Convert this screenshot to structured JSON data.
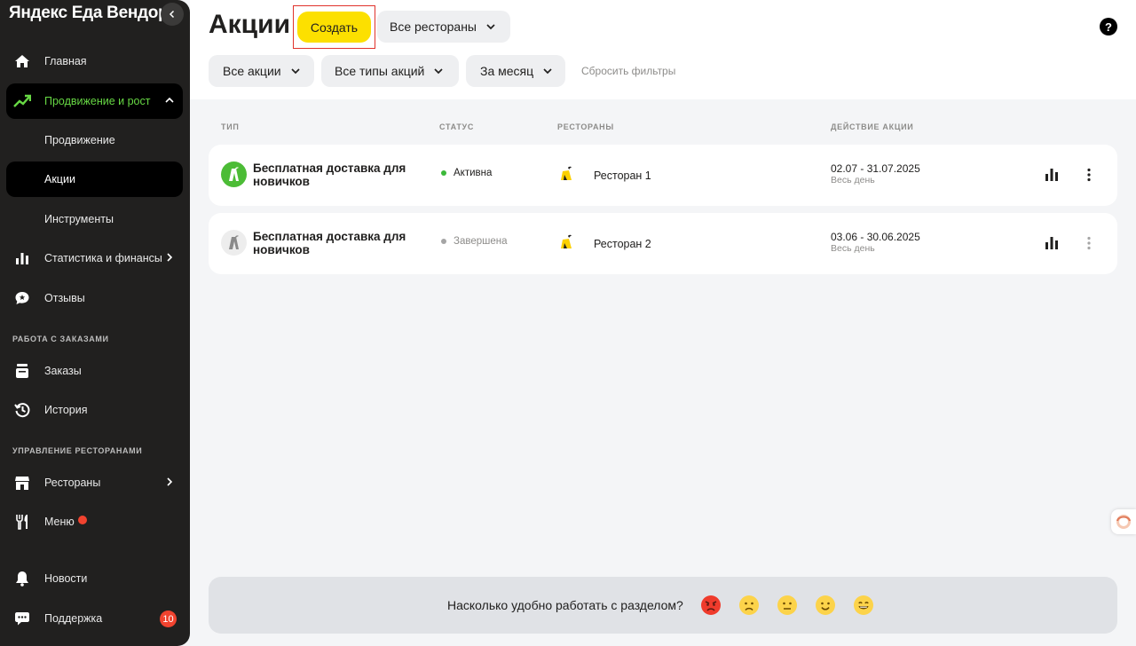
{
  "sidebar": {
    "brand": "Яндекс Еда Вендор",
    "items": {
      "home": "Главная",
      "promotion_growth": "Продвижение и рост",
      "promotion": "Продвижение",
      "actions": "Акции",
      "tools": "Инструменты",
      "stats_finance": "Статистика и финансы",
      "reviews": "Отзывы",
      "orders": "Заказы",
      "history": "История",
      "restaurants": "Рестораны",
      "menu": "Меню",
      "news": "Новости",
      "support": "Поддержка"
    },
    "sections": {
      "orders_work": "РАБОТА С ЗАКАЗАМИ",
      "restaurants_mgmt": "УПРАВЛЕНИЕ РЕСТОРАНАМИ"
    },
    "support_badge": "10"
  },
  "header": {
    "title": "Акции",
    "create_label": "Создать",
    "restaurants_filter": "Все рестораны",
    "filters": {
      "actions": "Все акции",
      "types": "Все типы акций",
      "period": "За месяц",
      "reset": "Сбросить фильтры"
    },
    "help": "?"
  },
  "table": {
    "columns": {
      "type": "ТИП",
      "status": "СТАТУС",
      "restaurants": "РЕСТОРАНЫ",
      "period": "ДЕЙСТВИЕ АКЦИИ"
    },
    "rows": [
      {
        "type": "Бесплатная доставка для новичков",
        "status": "Активна",
        "status_color": "#3cb93a",
        "restaurant": "Ресторан 1",
        "dates": "02.07 - 31.07.2025",
        "time": "Весь день"
      },
      {
        "type": "Бесплатная доставка для новичков",
        "status": "Завершена",
        "status_color": "#a5a5a5",
        "restaurant": "Ресторан 2",
        "dates": "03.06 - 30.06.2025",
        "time": "Весь день"
      }
    ]
  },
  "feedback": {
    "question": "Насколько удобно работать с разделом?",
    "options": [
      "angry-face",
      "sad-face",
      "neutral-face",
      "smile-face",
      "grin-face"
    ]
  },
  "colors": {
    "accent_yellow": "#fce000",
    "active_green": "#67d844",
    "sidebar_bg": "#21201f",
    "badge_red": "#f1432f"
  }
}
